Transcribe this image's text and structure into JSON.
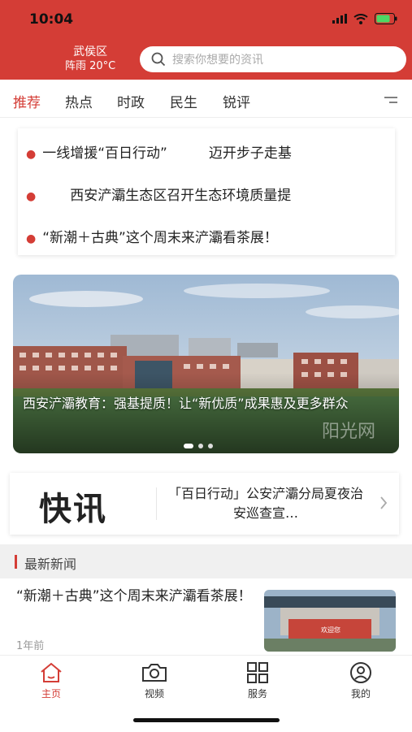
{
  "status": {
    "time": "10:04"
  },
  "header": {
    "location": "武侯区",
    "weather": "阵雨 20°C",
    "search_placeholder": "搜索你想要的资讯"
  },
  "tabs": [
    "推荐",
    "热点",
    "时政",
    "民生",
    "锐评"
  ],
  "headlines": [
    "一线增援“百日行动”　　　迈开步子走基",
    "　　西安浐灞生态区召开生态环境质量提",
    "“新潮＋古典”这个周末来浐灞看茶展！"
  ],
  "banner": {
    "caption": "西安浐灞教育：强基提质！让“新优质”成果惠及更多群众",
    "watermark": "阳光网"
  },
  "flash": {
    "logo": "快讯",
    "text": "「百日行动」公安浐灞分局夏夜治安巡查宣…"
  },
  "section": {
    "title": "最新新闻"
  },
  "news": {
    "title": "“新潮＋古典”这个周末来浐灞看茶展！",
    "time": "1年前",
    "thumb_text": "欢迎您"
  },
  "tabbar": [
    "主页",
    "视频",
    "服务",
    "我的"
  ],
  "colors": {
    "brand": "#d43d36"
  }
}
